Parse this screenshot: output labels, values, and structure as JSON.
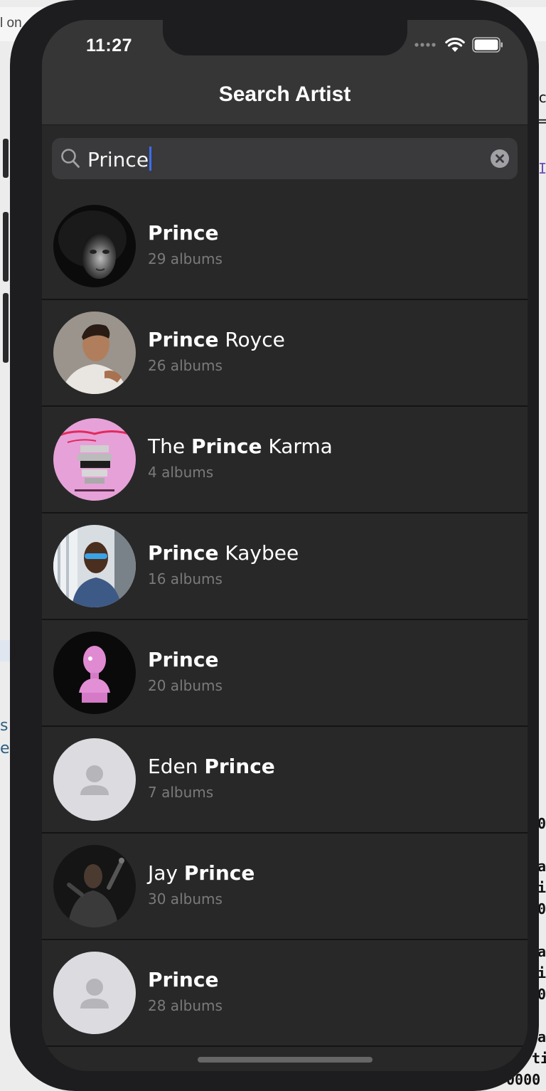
{
  "status_bar": {
    "time": "11:27"
  },
  "nav": {
    "title": "Search Artist"
  },
  "search": {
    "query": "Prince"
  },
  "artists": [
    {
      "pre": "",
      "match": "Prince",
      "post": "",
      "albums": "29 albums",
      "avatar": "photo-bw-portrait"
    },
    {
      "pre": "",
      "match": "Prince",
      "post": " Royce",
      "albums": "26 albums",
      "avatar": "photo-man-white-shirt"
    },
    {
      "pre": "The ",
      "match": "Prince",
      "post": " Karma",
      "albums": "4 albums",
      "avatar": "pink-album-art"
    },
    {
      "pre": "",
      "match": "Prince",
      "post": " Kaybee",
      "albums": "16 albums",
      "avatar": "photo-man-blue-shirt"
    },
    {
      "pre": "",
      "match": "Prince",
      "post": "",
      "albums": "20 albums",
      "avatar": "pink-bust-art"
    },
    {
      "pre": "Eden ",
      "match": "Prince",
      "post": "",
      "albums": "7 albums",
      "avatar": "placeholder-person"
    },
    {
      "pre": "Jay ",
      "match": "Prince",
      "post": "",
      "albums": "30 albums",
      "avatar": "photo-performer-dark"
    },
    {
      "pre": "",
      "match": "Prince",
      "post": "",
      "albums": "28 albums",
      "avatar": "placeholder-person"
    }
  ],
  "background": {
    "top_text": "l on",
    "left_text": [
      "s",
      "e"
    ],
    "right_text": [
      "c",
      "=",
      "I",
      "0",
      "a",
      "i",
      "0",
      "a",
      "i",
      "0",
      "a",
      "ti",
      "0000"
    ]
  }
}
